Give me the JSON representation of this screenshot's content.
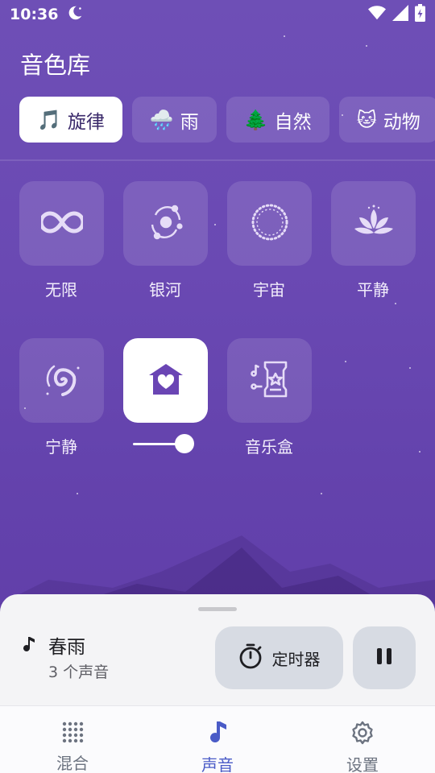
{
  "status_bar": {
    "time": "10:36",
    "icons": [
      "moon-icon",
      "wifi-icon",
      "signal-icon",
      "battery-charging-icon"
    ]
  },
  "page": {
    "title": "音色库"
  },
  "tabs": [
    {
      "emoji": "🎵",
      "label": "旋律",
      "active": true
    },
    {
      "emoji": "🌧️",
      "label": "雨",
      "active": false
    },
    {
      "emoji": "🌲",
      "label": "自然",
      "active": false
    },
    {
      "emoji": "🐱",
      "label": "动物",
      "active": false
    }
  ],
  "sounds": [
    {
      "label": "无限",
      "icon": "infinity-icon",
      "selected": false
    },
    {
      "label": "银河",
      "icon": "galaxy-icon",
      "selected": false
    },
    {
      "label": "宇宙",
      "icon": "universe-ring-icon",
      "selected": false
    },
    {
      "label": "平静",
      "icon": "lotus-icon",
      "selected": false
    },
    {
      "label": "宁静",
      "icon": "spiral-icon",
      "selected": false
    },
    {
      "label": "",
      "icon": "home-heart-icon",
      "selected": true,
      "volume": 0.82
    },
    {
      "label": "音乐盒",
      "icon": "music-box-icon",
      "selected": false
    }
  ],
  "now_playing": {
    "icon": "music-note-icon",
    "title": "春雨",
    "subtitle": "3 个声音",
    "timer_label": "定时器",
    "timer_icon": "stopwatch-icon",
    "pause_icon": "pause-icon"
  },
  "nav": [
    {
      "label": "混合",
      "icon": "dots-grid-icon",
      "active": false
    },
    {
      "label": "声音",
      "icon": "music-note-icon",
      "active": true
    },
    {
      "label": "设置",
      "icon": "gear-icon",
      "active": false
    }
  ],
  "colors": {
    "background_top": "#6e4fb6",
    "background_bottom": "#5e3aa6",
    "accent": "#4a5bc7",
    "tile_selected_icon": "#6a45b4"
  }
}
